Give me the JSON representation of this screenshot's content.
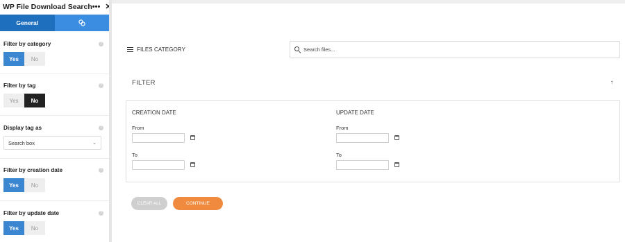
{
  "panel": {
    "title": "WP File Download Search",
    "menu_icon": "more-dots-icon",
    "close_icon": "close-icon",
    "tabs": [
      {
        "label": "General",
        "active": true
      },
      {
        "label": "",
        "icon": "style-brush-icon",
        "active": false
      }
    ],
    "settings": {
      "filter_by_category": {
        "label": "Filter by category",
        "yes": "Yes",
        "no": "No",
        "value": "Yes"
      },
      "filter_by_tag": {
        "label": "Filter by tag",
        "yes": "Yes",
        "no": "No",
        "value": "No"
      },
      "display_tag_as": {
        "label": "Display tag as",
        "value": "Search box"
      },
      "filter_by_creation_date": {
        "label": "Filter by creation date",
        "yes": "Yes",
        "no": "No",
        "value": "Yes"
      },
      "filter_by_update_date": {
        "label": "Filter by update date",
        "yes": "Yes",
        "no": "No",
        "value": "Yes"
      }
    },
    "colors": {
      "tab_active": "#1f6fbf",
      "tab_inactive": "#3a8de0",
      "toggle_on": "#3b86d0",
      "toggle_dark": "#222222"
    }
  },
  "main": {
    "category_menu": "FILES CATEGORY",
    "search": {
      "placeholder": "Search files..."
    },
    "filter": {
      "title": "FILTER",
      "creation": {
        "title": "CREATION DATE",
        "from": "From",
        "to": "To"
      },
      "update": {
        "title": "UPDATE DATE",
        "from": "From",
        "to": "To"
      }
    },
    "buttons": {
      "clear": "CLEAR ALL",
      "continue": "CONTINUE"
    },
    "colors": {
      "continue": "#f08a3e",
      "clear": "#cfcfcf"
    }
  }
}
